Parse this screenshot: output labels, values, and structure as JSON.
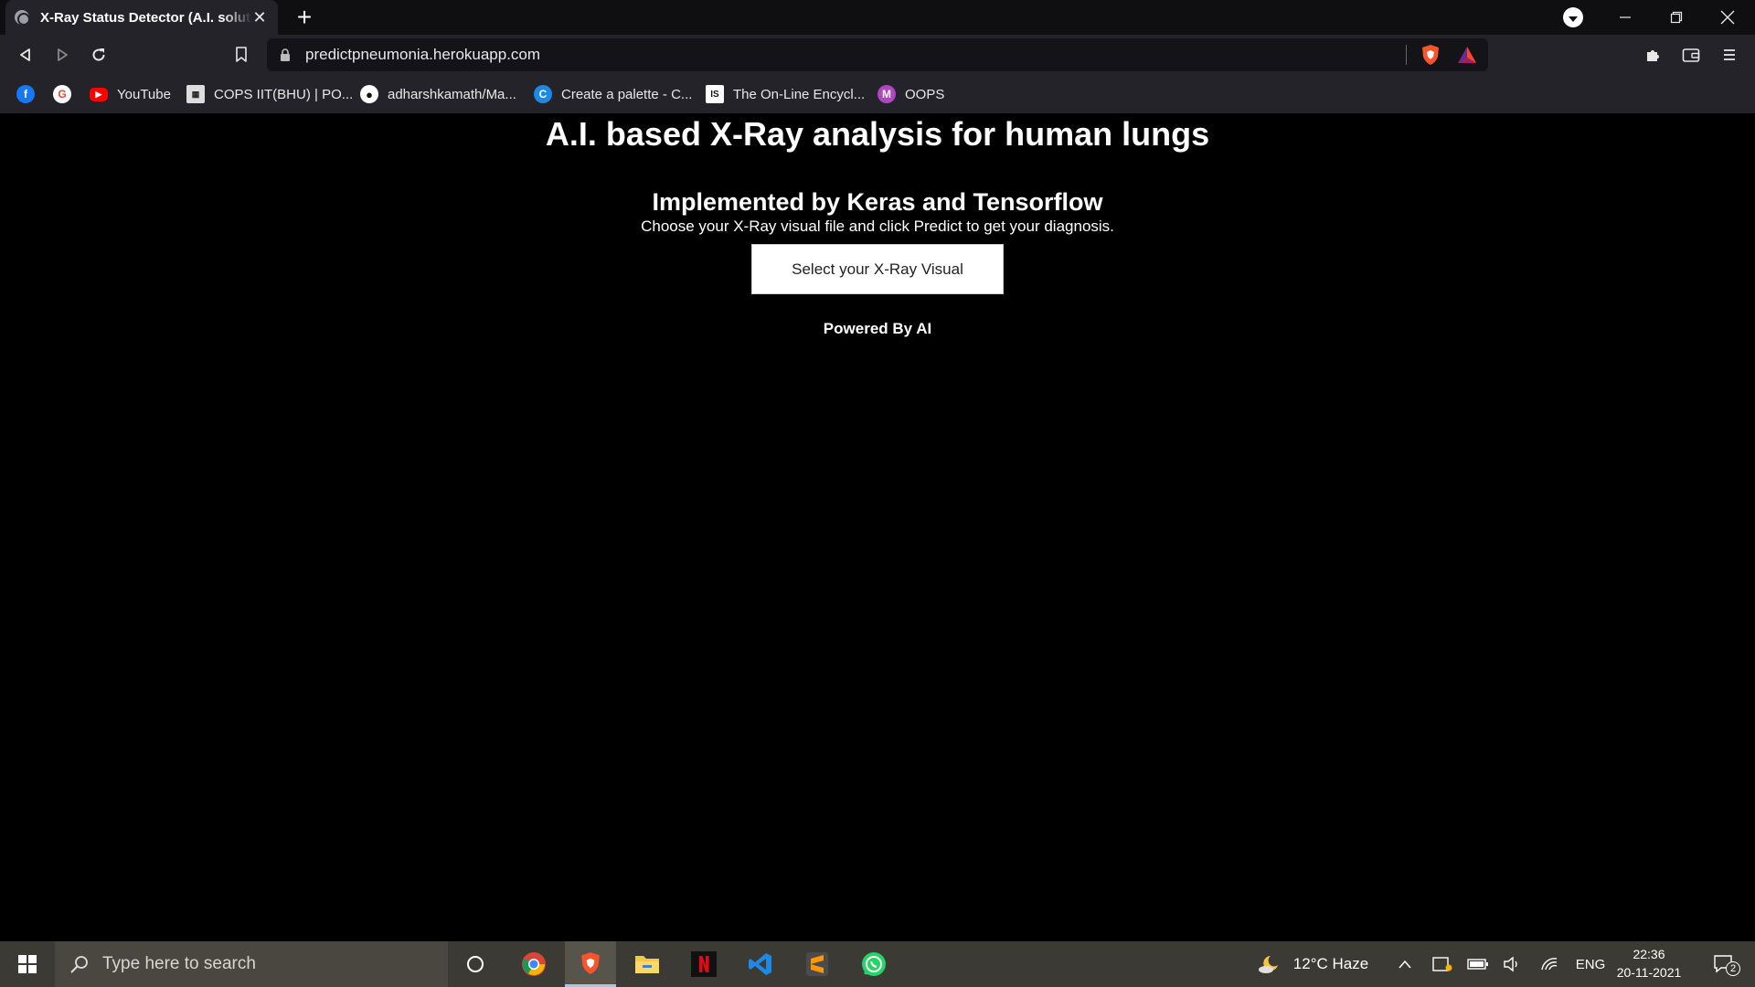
{
  "browser": {
    "tab_title": "X-Ray Status Detector (A.I. solution",
    "url": "predictpneumonia.herokuapp.com",
    "bookmarks": [
      {
        "label": ""
      },
      {
        "label": ""
      },
      {
        "label": "YouTube"
      },
      {
        "label": "COPS IIT(BHU) | PO..."
      },
      {
        "label": "adharshkamath/Ma..."
      },
      {
        "label": "Create a palette - C..."
      },
      {
        "label": "The On-Line Encycl..."
      },
      {
        "label": "OOPS"
      }
    ]
  },
  "page": {
    "headline": "A.I. based X-Ray analysis for human lungs",
    "subhead": "Implemented by Keras and Tensorflow",
    "instructions": "Choose your X-Ray visual file and click Predict to get your diagnosis.",
    "select_button": "Select your X-Ray Visual",
    "powered_by": "Powered By AI"
  },
  "taskbar": {
    "search_placeholder": "Type here to search",
    "weather": "12°C  Haze",
    "language": "ENG",
    "time": "22:36",
    "date": "20-11-2021",
    "notifications": "2"
  }
}
